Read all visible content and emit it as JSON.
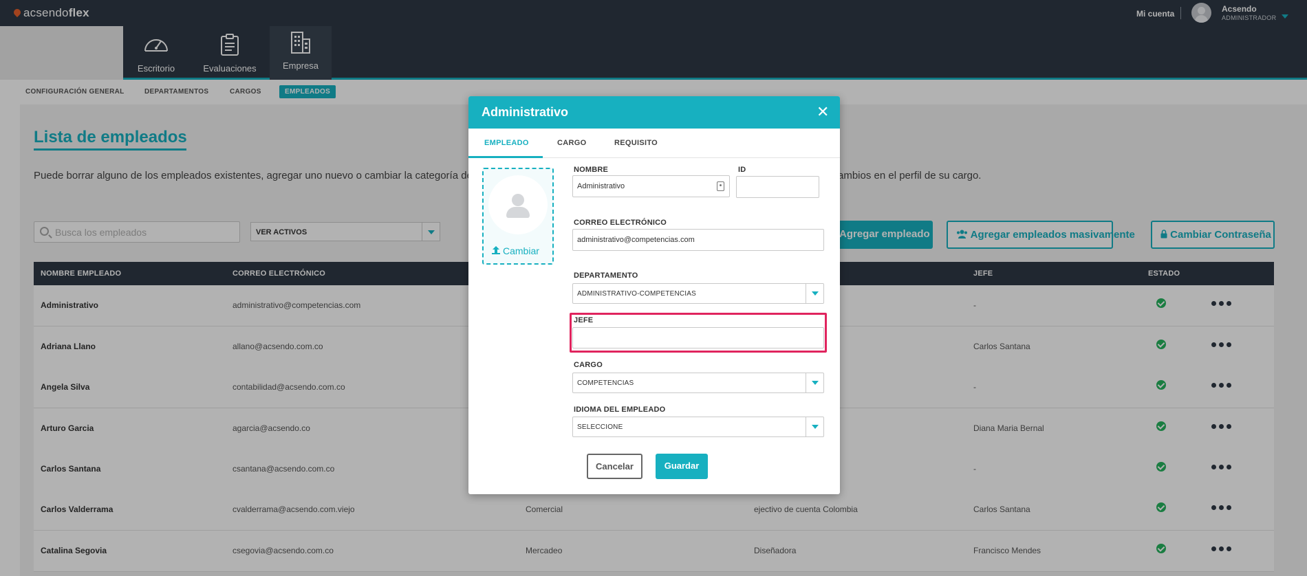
{
  "brand": {
    "logo_prefix": "acsendo",
    "logo_suffix": "flex"
  },
  "topbar": {
    "account_label": "Mi cuenta",
    "user_name": "Acsendo",
    "user_role": "ADMINISTRADOR"
  },
  "nav": [
    {
      "label": "Escritorio"
    },
    {
      "label": "Evaluaciones"
    },
    {
      "label": "Empresa"
    }
  ],
  "subnav": [
    {
      "label": "CONFIGURACIÓN GENERAL"
    },
    {
      "label": "DEPARTAMENTOS"
    },
    {
      "label": "CARGOS"
    },
    {
      "label": "EMPLEADOS"
    }
  ],
  "page": {
    "title": "Lista de empleados",
    "desc_left": "Puede borrar alguno de los empleados existentes, agregar uno nuevo o cambiar la categoría de c",
    "desc_right": "ambios en el perfil de su cargo."
  },
  "filters": {
    "search_placeholder": "Busca los empleados",
    "status_select": "VER ACTIVOS"
  },
  "actions": {
    "add_employee": "Agregar empleado",
    "add_bulk": "Agregar empleados masivamente",
    "change_password": "Cambiar Contraseña"
  },
  "table": {
    "headers": [
      "NOMBRE EMPLEADO",
      "CORREO ELECTRÓNICO",
      "JEFE",
      "ESTADO"
    ],
    "rows": [
      {
        "name": "Administrativo",
        "email": "administrativo@competencias.com",
        "dept": "",
        "cargo": "",
        "jefe": "-"
      },
      {
        "name": "Adriana Llano",
        "email": "allano@acsendo.com.co",
        "dept": "",
        "cargo": "",
        "jefe": "Carlos Santana"
      },
      {
        "name": "Angela Silva",
        "email": "contabilidad@acsendo.com.co",
        "dept": "",
        "cargo": "",
        "jefe": "-"
      },
      {
        "name": "Arturo Garcia",
        "email": "agarcia@acsendo.co",
        "dept": "",
        "cargo": "",
        "jefe": "Diana Maria Bernal"
      },
      {
        "name": "Carlos Santana",
        "email": "csantana@acsendo.com.co",
        "dept": "",
        "cargo": "",
        "jefe": "-"
      },
      {
        "name": "Carlos Valderrama",
        "email": "cvalderrama@acsendo.com.viejo",
        "dept": "Comercial",
        "cargo": "ejectivo de cuenta Colombia",
        "jefe": "Carlos Santana"
      },
      {
        "name": "Catalina Segovia",
        "email": "csegovia@acsendo.com.co",
        "dept": "Mercadeo",
        "cargo": "Diseñadora",
        "jefe": "Francisco Mendes"
      }
    ]
  },
  "modal": {
    "title": "Administrativo",
    "close_symbol": "✕",
    "tabs": [
      "EMPLEADO",
      "CARGO",
      "REQUISITO"
    ],
    "photo_change_label": "Cambiar",
    "fields": {
      "nombre_label": "NOMBRE",
      "nombre_value": "Administrativo",
      "id_label": "ID",
      "id_value": "",
      "email_label": "CORREO ELECTRÓNICO",
      "email_value": "administrativo@competencias.com",
      "departamento_label": "DEPARTAMENTO",
      "departamento_value": "ADMINISTRATIVO-COMPETENCIAS",
      "jefe_label": "JEFE",
      "jefe_value": "",
      "cargo_label": "CARGO",
      "cargo_value": "COMPETENCIAS",
      "idioma_label": "IDIOMA DEL EMPLEADO",
      "idioma_value": "SELECCIONE"
    },
    "cancel_label": "Cancelar",
    "save_label": "Guardar"
  },
  "colors": {
    "accent": "#17b0c0",
    "dark": "#2f3945",
    "highlight": "#e0245e",
    "status_ok": "#26b35e"
  }
}
